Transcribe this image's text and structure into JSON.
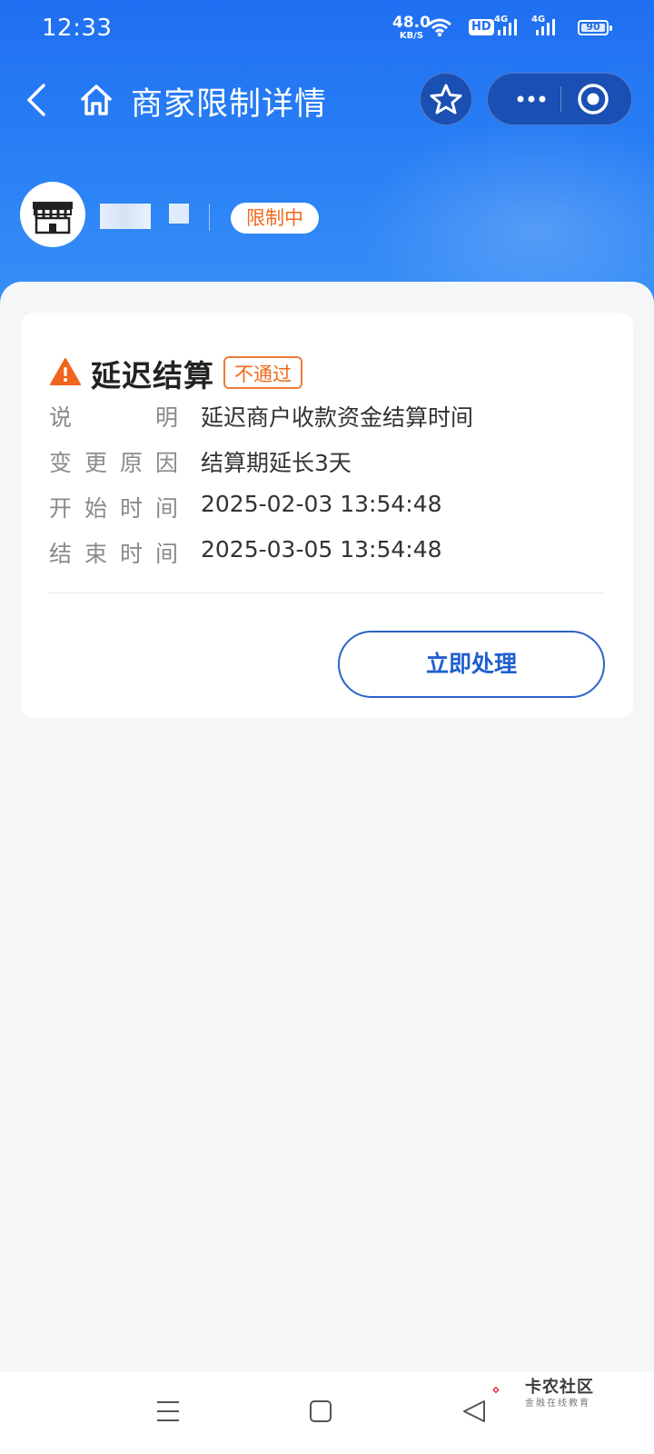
{
  "status_bar": {
    "time": "12:33",
    "net_speed": "48.0",
    "net_unit": "KB/S",
    "hd_label": "HD",
    "sim1_label": "4G",
    "sim2_label": "4G",
    "battery": "90"
  },
  "nav": {
    "title": "商家限制详情"
  },
  "merchant": {
    "status_badge": "限制中"
  },
  "card": {
    "title": "延迟结算",
    "status_tag": "不通过",
    "rows": [
      {
        "label": "说明",
        "value": "延迟商户收款资金结算时间"
      },
      {
        "label": "变更原因",
        "value": "结算期延长3天"
      },
      {
        "label": "开始时间",
        "value": "2025-02-03 13:54:48"
      },
      {
        "label": "结束时间",
        "value": "2025-03-05 13:54:48"
      }
    ],
    "action_label": "立即处理"
  },
  "watermark": {
    "main": "卡农社区",
    "sub": "金融在线教育"
  },
  "colors": {
    "header_blue": "#1f6ff2",
    "accent_orange": "#f06a1b",
    "button_blue": "#2a63c8"
  }
}
